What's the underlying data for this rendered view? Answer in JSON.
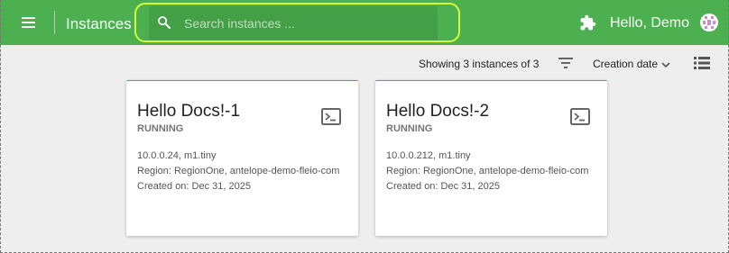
{
  "header": {
    "title": "Instances",
    "search_placeholder": "Search instances ...",
    "greeting": "Hello, Demo",
    "menu_icon": "hamburger-menu-icon",
    "search_icon": "search-icon",
    "plugin_icon": "puzzle-icon",
    "avatar_icon": "avatar-icon"
  },
  "toolbar": {
    "showing_text": "Showing 3 instances of 3",
    "sort_label": "Creation date",
    "filter_icon": "filter-icon",
    "view_toggle_icon": "list-view-icon"
  },
  "instances": [
    {
      "name": "Hello Docs!-1",
      "status": "RUNNING",
      "network_flavor": "10.0.0.24, m1.tiny",
      "region": "Region: RegionOne, antelope-demo-fleio-com",
      "created": "Created on: Dec 31, 2025"
    },
    {
      "name": "Hello Docs!-2",
      "status": "RUNNING",
      "network_flavor": "10.0.0.212, m1.tiny",
      "region": "Region: RegionOne, antelope-demo-fleio-com",
      "created": "Created on: Dec 31, 2025"
    }
  ],
  "colors": {
    "primary": "#4caf50",
    "search_background": "#43a047",
    "focus_ring": "#d7ff3b",
    "page_background": "#eeeeee"
  }
}
